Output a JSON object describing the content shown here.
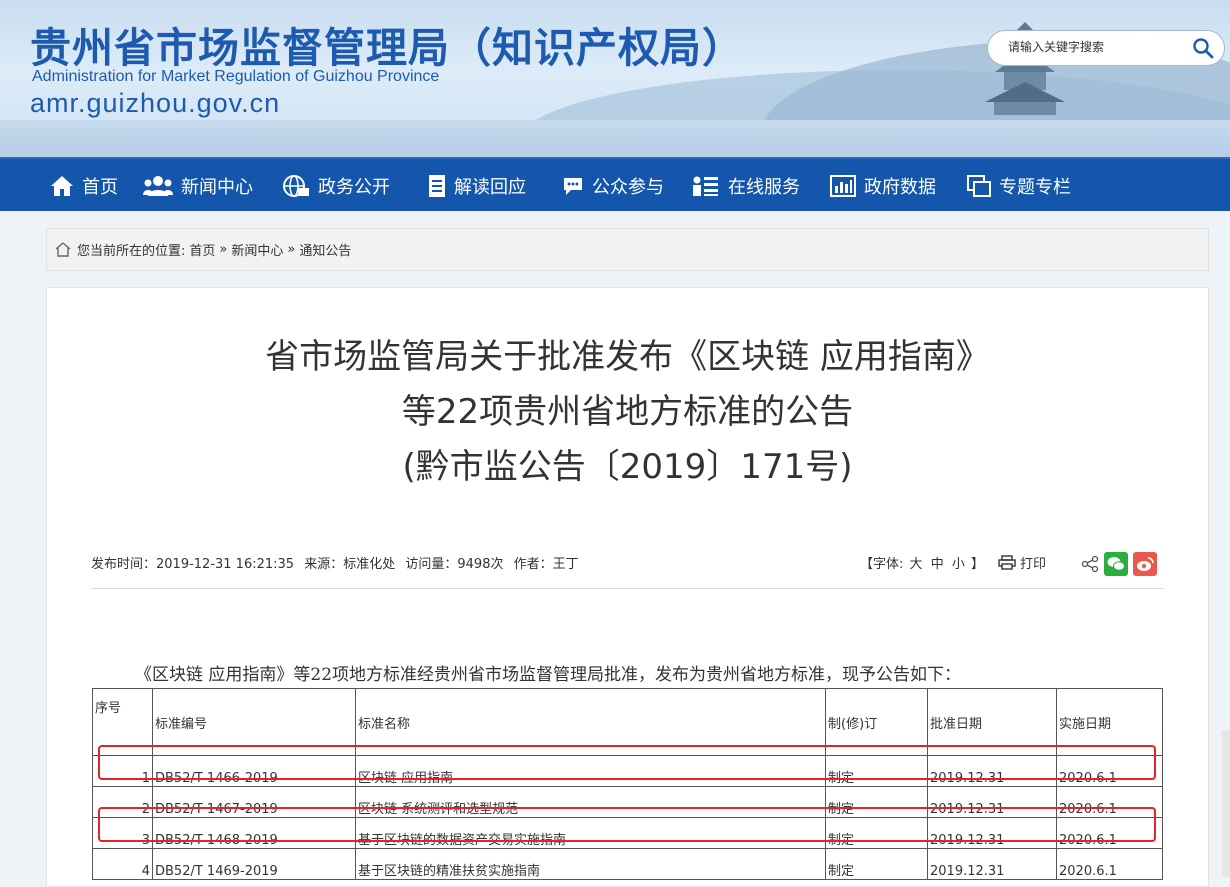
{
  "header": {
    "title": "贵州省市场监督管理局（知识产权局）",
    "subtitle_en": "Administration for Market Regulation of Guizhou Province",
    "url": "amr.guizhou.gov.cn",
    "search_placeholder": "请输入关键字搜索"
  },
  "nav": {
    "items": [
      {
        "label": "首页",
        "icon": "home-icon"
      },
      {
        "label": "新闻中心",
        "icon": "people-icon"
      },
      {
        "label": "政务公开",
        "icon": "globe-icon"
      },
      {
        "label": "解读回应",
        "icon": "document-icon"
      },
      {
        "label": "公众参与",
        "icon": "chat-icon"
      },
      {
        "label": "在线服务",
        "icon": "list-icon"
      },
      {
        "label": "政府数据",
        "icon": "bar-chart-icon"
      },
      {
        "label": "专题专栏",
        "icon": "window-icon"
      }
    ]
  },
  "breadcrumb": {
    "prefix": "您当前所在的位置:",
    "home": "首页",
    "sep": "»",
    "level1": "新闻中心",
    "level2": "通知公告"
  },
  "article": {
    "title_line1": "省市场监管局关于批准发布《区块链 应用指南》",
    "title_line2": "等22项贵州省地方标准的公告",
    "title_line3": "(黔市监公告〔2019〕171号)",
    "meta": {
      "publish": "发布时间：2019-12-31 16:21:35",
      "source": "来源：标准化处",
      "views": "访问量：9498次",
      "author": "作者：王丁"
    },
    "font_label": "【字体:",
    "font_big": "大",
    "font_mid": "中",
    "font_small": "小",
    "font_close": "】",
    "print_label": "打印",
    "intro": "《区块链  应用指南》等22项地方标准经贵州省市场监督管理局批准，发布为贵州省地方标准，现予公告如下：",
    "table": {
      "headers": [
        "序号",
        "标准编号",
        "标准名称",
        "制(修)订",
        "批准日期",
        "实施日期"
      ],
      "rows": [
        [
          "1",
          "DB52/T   1466-2019",
          "区块链 应用指南",
          "制定",
          "2019.12.31",
          "2020.6.1"
        ],
        [
          "2",
          "DB52/T   1467-2019",
          "区块链 系统测评和选型规范",
          "制定",
          "2019.12.31",
          "2020.6.1"
        ],
        [
          "3",
          "DB52/T   1468-2019",
          "基于区块链的数据资产交易实施指南",
          "制定",
          "2019.12.31",
          "2020.6.1"
        ],
        [
          "4",
          "DB52/T   1469-2019",
          "基于区块链的精准扶贫实施指南",
          "制定",
          "2019.12.31",
          "2020.6.1"
        ]
      ]
    }
  },
  "colors": {
    "nav_bg": "#1356ac",
    "title_blue": "#1e5bb0",
    "highlight": "#e52324",
    "wechat": "#2aae3e",
    "weibo": "#e8584c"
  }
}
